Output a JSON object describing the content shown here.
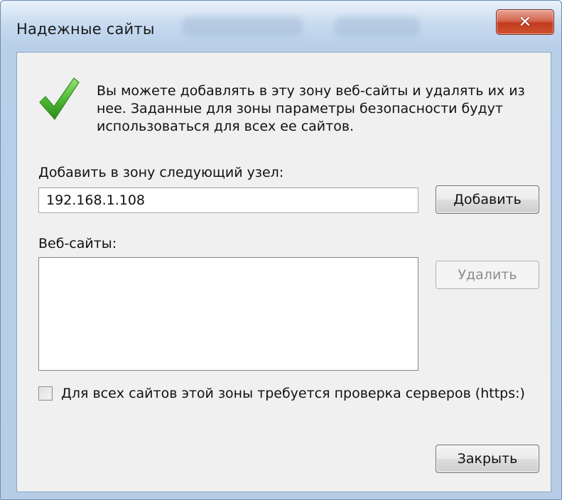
{
  "window": {
    "title": "Надежные сайты",
    "close_glyph": "✕"
  },
  "dialog": {
    "info_icon": "green-checkmark-icon",
    "description": "Вы можете добавлять в эту зону  веб-сайты и удалять их из нее. Заданные для зоны параметры безопасности будут использоваться для всех ее сайтов.",
    "add_zone_label": "Добавить в зону следующий узел:",
    "add_zone_value": "192.168.1.108",
    "add_button": "Добавить",
    "websites_label": "Веб-сайты:",
    "websites": [],
    "remove_button": "Удалить",
    "remove_button_enabled": false,
    "https_checkbox_label": "Для всех сайтов этой зоны требуется проверка серверов (https:)",
    "https_checkbox_checked": false,
    "close_button": "Закрыть"
  },
  "colors": {
    "frame": "#b8cfe8",
    "client": "#f0f0f0",
    "close_red": "#c23a1f",
    "check_green": "#3fa62b"
  }
}
